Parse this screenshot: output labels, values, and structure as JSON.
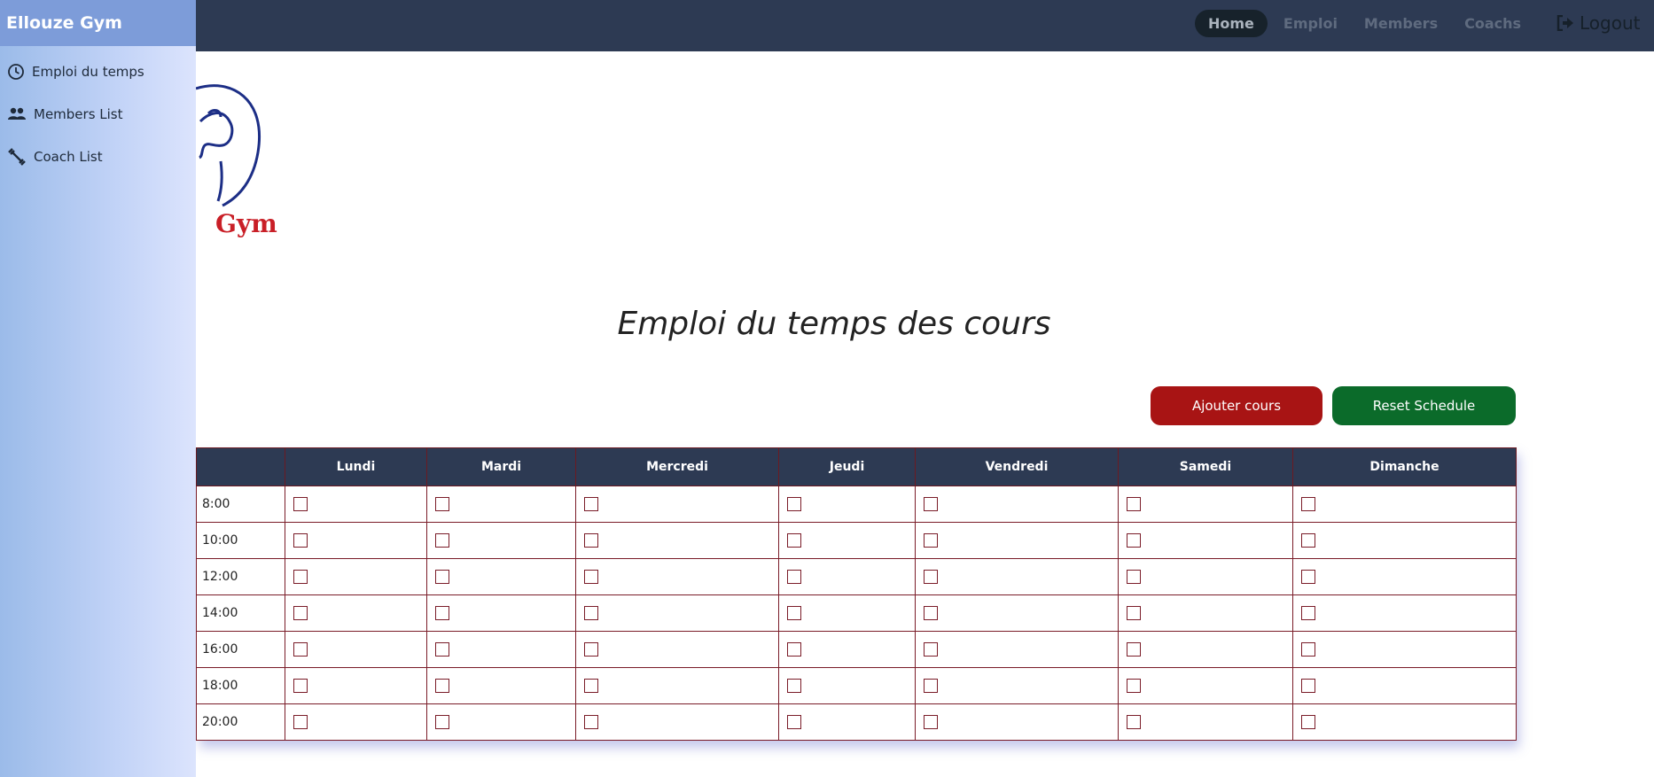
{
  "sidebar": {
    "title": "Ellouze Gym",
    "items": [
      {
        "label": "Emploi du temps",
        "icon": "clock-icon"
      },
      {
        "label": "Members List",
        "icon": "people-icon"
      },
      {
        "label": "Coach List",
        "icon": "dumbbell-icon"
      }
    ]
  },
  "navbar": {
    "items": [
      {
        "label": "Home",
        "active": true
      },
      {
        "label": "Emploi",
        "active": false
      },
      {
        "label": "Members",
        "active": false
      },
      {
        "label": "Coachs",
        "active": false
      }
    ],
    "logout_label": "Logout"
  },
  "logo": {
    "text": "Gym"
  },
  "main": {
    "title": "Emploi du temps des cours",
    "add_button": "Ajouter cours",
    "reset_button": "Reset Schedule"
  },
  "schedule": {
    "days": [
      "Lundi",
      "Mardi",
      "Mercredi",
      "Jeudi",
      "Vendredi",
      "Samedi",
      "Dimanche"
    ],
    "times": [
      "8:00",
      "10:00",
      "12:00",
      "14:00",
      "16:00",
      "18:00",
      "20:00"
    ]
  },
  "colors": {
    "navbar": "#2d3a53",
    "add_button": "#a81414",
    "reset_button": "#0b6b2a",
    "table_border": "#7a1c28"
  }
}
